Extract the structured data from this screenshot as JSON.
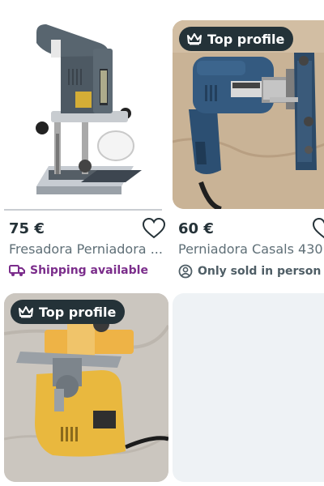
{
  "products": [
    {
      "price": "75 €",
      "title": "Fresadora Perniadora ...",
      "delivery": "Shipping available",
      "badge": "",
      "image": "router-tool-image"
    },
    {
      "price": "60 €",
      "title": "Perniadora Casals 430...",
      "delivery": "Only sold in person",
      "badge": "Top profile",
      "image": "perniadora-blue-image"
    },
    {
      "price": "",
      "title": "",
      "delivery": "",
      "badge": "Top profile",
      "image": "perniadora-yellow-image"
    }
  ],
  "icons": {
    "favorite": "heart-outline-icon",
    "shipping": "truck-icon",
    "in_person": "person-icon",
    "badge": "crown-icon"
  },
  "colors": {
    "accent_purple": "#7b2d8b",
    "badge_bg": "#243238",
    "placeholder_bg": "#eef2f5"
  }
}
